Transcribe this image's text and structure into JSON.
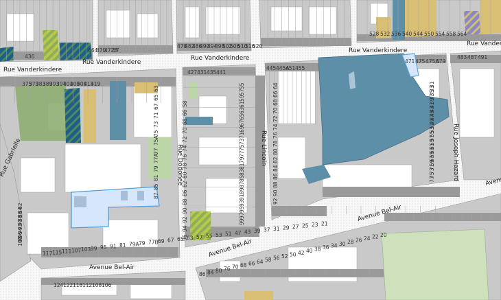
{
  "map": {
    "colors": {
      "road": "#fcfcfc",
      "block_bg": "#cfcfcf",
      "building_grey": "#9c9c9c",
      "building_white": "#ffffff",
      "teal": "#5e8fa8",
      "green": "#8fae72",
      "light_green": "#bcd6a8",
      "sand": "#d9bf74",
      "selected_fill": "#d6e6fb",
      "selected_stroke": "#5aa7e0",
      "park": "#cfe0bc"
    },
    "streets": [
      {
        "id": "rue-vanderkindere-left",
        "label": "Rue Vanderkindere"
      },
      {
        "id": "rue-vanderkindere-mid",
        "label": "Rue Vanderkindere"
      },
      {
        "id": "rue-vanderkindere-right",
        "label": "Rue Vanderkindere"
      },
      {
        "id": "rue-vanderkindere-far",
        "label": "Rue Vanderkinde"
      },
      {
        "id": "rue-gabrielle",
        "label": "Rue Gabrielle"
      },
      {
        "id": "rue-dodonee",
        "label": "Rue Dodonée"
      },
      {
        "id": "rue-lincoln",
        "label": "Rue Lincoln"
      },
      {
        "id": "rue-joseph-hazard",
        "label": "Rue Joseph Hazard"
      },
      {
        "id": "avenue-bel-air-1",
        "label": "Avenue Bel-Air"
      },
      {
        "id": "avenue-bel-air-2",
        "label": "Avenue Bel-Air"
      },
      {
        "id": "avenue-bel-air-3",
        "label": "Avenue Bel-Air"
      },
      {
        "id": "avenue-edge",
        "label": "Avenu"
      }
    ],
    "numbers": {
      "top_left": [
        "436",
        "464",
        "470",
        "472A",
        "57"
      ],
      "top_mid": [
        "478",
        "482",
        "486",
        "490",
        "494",
        "498",
        "502",
        "506",
        "510",
        "516",
        "520"
      ],
      "top_right": [
        "528",
        "532",
        "536",
        "540",
        "544",
        "550",
        "554",
        "558",
        "564"
      ],
      "vanderkindere_south": [
        "375",
        "379",
        "383",
        "389",
        "393",
        "397",
        "401",
        "405",
        "409",
        "413",
        "419",
        "427",
        "431",
        "435",
        "441",
        "445",
        "445A",
        "451",
        "455",
        "471",
        "475",
        "475A",
        "479",
        "483",
        "487",
        "491"
      ],
      "dodonee_west": [
        "63",
        "65",
        "67",
        "71",
        "73",
        "75",
        "75A",
        "77",
        "77A",
        "79",
        "81",
        "85",
        "87"
      ],
      "dodonee_east": [
        "58",
        "66",
        "68",
        "70",
        "72",
        "74",
        "76",
        "78",
        "80",
        "82",
        "86",
        "88",
        "90",
        "92",
        "94",
        "96"
      ],
      "lincoln_west": [
        "55",
        "57",
        "59",
        "61",
        "63",
        "65",
        "67",
        "69",
        "71",
        "73",
        "75",
        "77",
        "79",
        "81",
        "83",
        "85",
        "87",
        "89",
        "91",
        "93",
        "95",
        "97",
        "99"
      ],
      "lincoln_east": [
        "64",
        "66",
        "68",
        "70",
        "72",
        "74",
        "76",
        "78",
        "80",
        "82",
        "84",
        "86",
        "88",
        "90",
        "92"
      ],
      "hazard": [
        "31",
        "33",
        "35",
        "37",
        "39",
        "41",
        "43",
        "45",
        "47",
        "49",
        "51",
        "53",
        "55",
        "57",
        "59",
        "61",
        "63",
        "65",
        "67",
        "69",
        "71",
        "73",
        "75",
        "77"
      ],
      "belair_north": [
        "117",
        "115",
        "111",
        "107",
        "103",
        "99",
        "95",
        "91",
        "81",
        "79A",
        "79",
        "77B",
        "69",
        "67",
        "65",
        "63",
        "57",
        "55",
        "53",
        "51",
        "47",
        "43",
        "39",
        "37",
        "31",
        "29",
        "27",
        "25",
        "23",
        "21"
      ],
      "belair_south": [
        "86",
        "84",
        "80",
        "76",
        "70",
        "68",
        "66",
        "64",
        "58",
        "56",
        "52",
        "50",
        "42",
        "40",
        "38",
        "36",
        "34",
        "30",
        "28",
        "26",
        "24",
        "22",
        "20"
      ],
      "bottom_left": [
        "124",
        "122",
        "118",
        "112",
        "108",
        "106"
      ],
      "gabrielle": [
        "82",
        "84",
        "86",
        "88",
        "90",
        "92",
        "94",
        "96",
        "98",
        "100"
      ]
    }
  }
}
